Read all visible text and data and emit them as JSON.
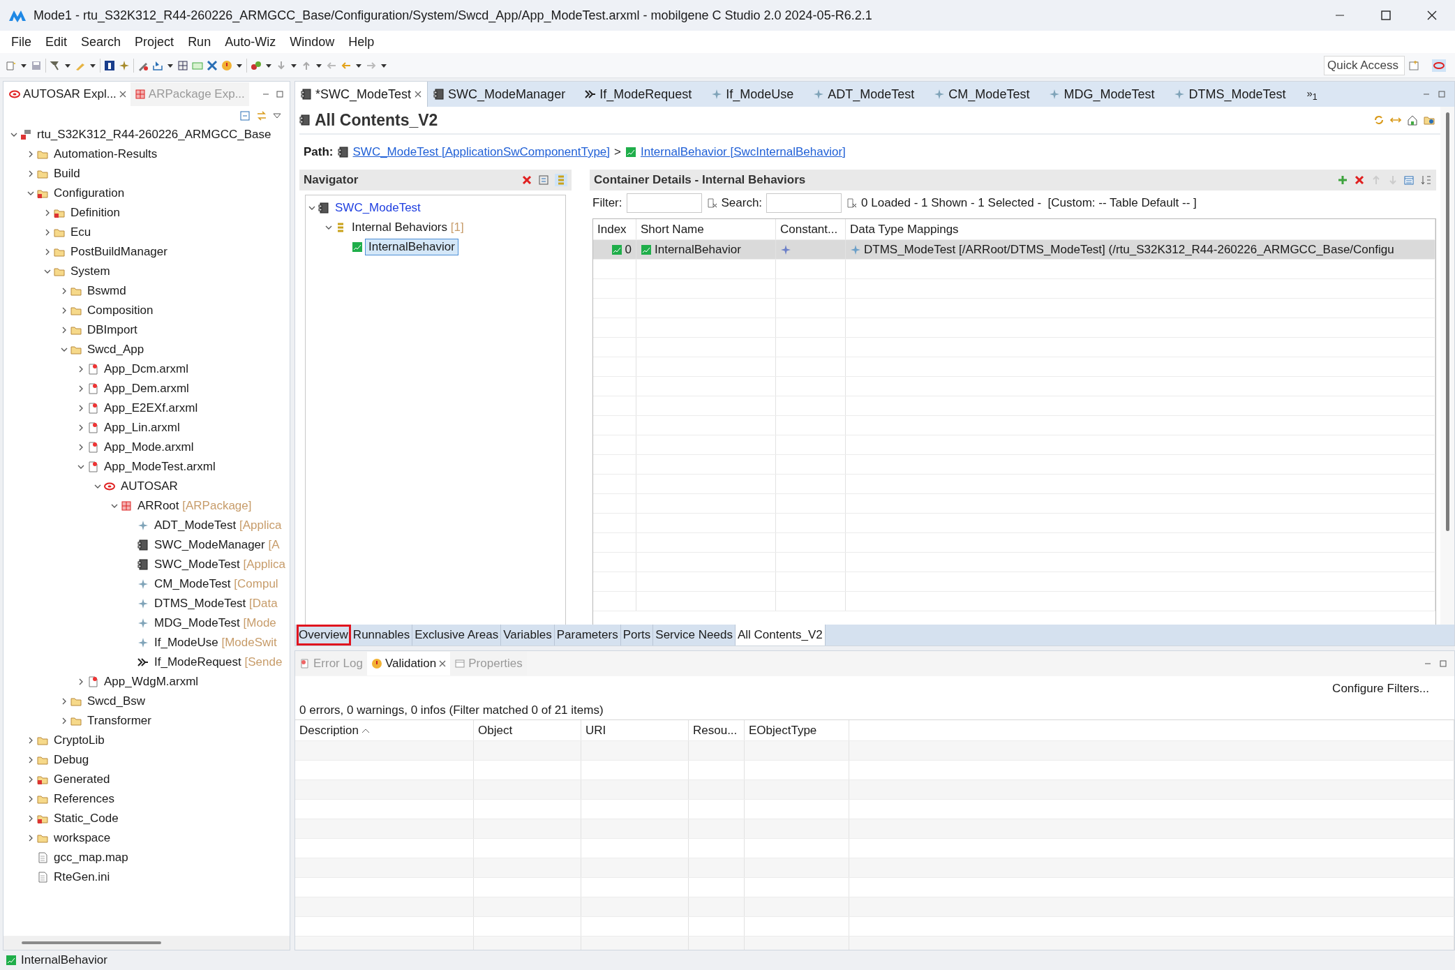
{
  "window": {
    "title": "Mode1 - rtu_S32K312_R44-260226_ARMGCC_Base/Configuration/System/Swcd_App/App_ModeTest.arxml - mobilgene C Studio 2.0 2024-05-R6.2.1"
  },
  "menu": [
    "File",
    "Edit",
    "Search",
    "Project",
    "Run",
    "Auto-Wiz",
    "Window",
    "Help"
  ],
  "quick_access": {
    "placeholder": "Quick Access"
  },
  "explorer": {
    "tabs": [
      {
        "label": "AUTOSAR Expl...",
        "selected": true
      },
      {
        "label": "ARPackage Exp...",
        "selected": false
      }
    ],
    "tree": [
      {
        "label": "rtu_S32K312_R44-260226_ARMGCC_Base",
        "kind": "project",
        "expanded": true,
        "children": [
          {
            "label": "Automation-Results",
            "kind": "folder",
            "expanded": false
          },
          {
            "label": "Build",
            "kind": "folder",
            "expanded": false
          },
          {
            "label": "Configuration",
            "kind": "errorfolder",
            "expanded": true,
            "children": [
              {
                "label": "Definition",
                "kind": "errorfolder",
                "expanded": false
              },
              {
                "label": "Ecu",
                "kind": "folder",
                "expanded": false
              },
              {
                "label": "PostBuildManager",
                "kind": "folder",
                "expanded": false
              },
              {
                "label": "System",
                "kind": "folder",
                "expanded": true,
                "children": [
                  {
                    "label": "Bswmd",
                    "kind": "folder",
                    "expanded": false
                  },
                  {
                    "label": "Composition",
                    "kind": "folder",
                    "expanded": false
                  },
                  {
                    "label": "DBImport",
                    "kind": "folder",
                    "expanded": false
                  },
                  {
                    "label": "Swcd_App",
                    "kind": "folder",
                    "expanded": true,
                    "children": [
                      {
                        "label": "App_Dcm.arxml",
                        "kind": "arxml",
                        "expanded": false
                      },
                      {
                        "label": "App_Dem.arxml",
                        "kind": "arxml",
                        "expanded": false
                      },
                      {
                        "label": "App_E2EXf.arxml",
                        "kind": "arxml",
                        "expanded": false
                      },
                      {
                        "label": "App_Lin.arxml",
                        "kind": "arxml",
                        "expanded": false
                      },
                      {
                        "label": "App_Mode.arxml",
                        "kind": "arxml",
                        "expanded": false
                      },
                      {
                        "label": "App_ModeTest.arxml",
                        "kind": "arxml",
                        "expanded": true,
                        "children": [
                          {
                            "label": "AUTOSAR",
                            "kind": "autosar",
                            "expanded": true,
                            "children": [
                              {
                                "label": "ARRoot",
                                "suffix": "[ARPackage]",
                                "kind": "package",
                                "expanded": true,
                                "children": [
                                  {
                                    "label": "ADT_ModeTest",
                                    "suffix": "[Applica",
                                    "kind": "element"
                                  },
                                  {
                                    "label": "SWC_ModeManager",
                                    "suffix": "[A",
                                    "kind": "component"
                                  },
                                  {
                                    "label": "SWC_ModeTest",
                                    "suffix": "[Applica",
                                    "kind": "component"
                                  },
                                  {
                                    "label": "CM_ModeTest",
                                    "suffix": "[Compul",
                                    "kind": "element"
                                  },
                                  {
                                    "label": "DTMS_ModeTest",
                                    "suffix": "[Data",
                                    "kind": "element"
                                  },
                                  {
                                    "label": "MDG_ModeTest",
                                    "suffix": "[Mode",
                                    "kind": "element"
                                  },
                                  {
                                    "label": "If_ModeUse",
                                    "suffix": "[ModeSwit",
                                    "kind": "element"
                                  },
                                  {
                                    "label": "If_ModeRequest",
                                    "suffix": "[Sende",
                                    "kind": "port"
                                  }
                                ]
                              }
                            ]
                          }
                        ]
                      },
                      {
                        "label": "App_WdgM.arxml",
                        "kind": "arxml",
                        "expanded": false
                      }
                    ]
                  },
                  {
                    "label": "Swcd_Bsw",
                    "kind": "folder",
                    "expanded": false
                  },
                  {
                    "label": "Transformer",
                    "kind": "folder",
                    "expanded": false
                  }
                ]
              }
            ]
          },
          {
            "label": "CryptoLib",
            "kind": "folder",
            "expanded": false
          },
          {
            "label": "Debug",
            "kind": "folder",
            "expanded": false
          },
          {
            "label": "Generated",
            "kind": "errorfolder",
            "expanded": false
          },
          {
            "label": "References",
            "kind": "folder",
            "expanded": false
          },
          {
            "label": "Static_Code",
            "kind": "errorfolder",
            "expanded": false
          },
          {
            "label": "workspace",
            "kind": "folder",
            "expanded": false
          },
          {
            "label": "gcc_map.map",
            "kind": "file"
          },
          {
            "label": "RteGen.ini",
            "kind": "file"
          }
        ]
      }
    ]
  },
  "editor_tabs": [
    {
      "label": "*SWC_ModeTest",
      "kind": "component",
      "selected": true
    },
    {
      "label": "SWC_ModeManager",
      "kind": "component",
      "selected": false
    },
    {
      "label": "If_ModeRequest",
      "kind": "port",
      "selected": false
    },
    {
      "label": "If_ModeUse",
      "kind": "element",
      "selected": false
    },
    {
      "label": "ADT_ModeTest",
      "kind": "element",
      "selected": false
    },
    {
      "label": "CM_ModeTest",
      "kind": "element",
      "selected": false
    },
    {
      "label": "MDG_ModeTest",
      "kind": "element",
      "selected": false
    },
    {
      "label": "DTMS_ModeTest",
      "kind": "element",
      "selected": false
    }
  ],
  "editor_tabs_overflow": "»$_{1}$",
  "editor": {
    "title": "All Contents_V2",
    "path": {
      "label": "Path:",
      "separator": ">",
      "links": [
        {
          "label": "SWC_ModeTest [ApplicationSwComponentType]",
          "kind": "component"
        },
        {
          "label": "InternalBehavior [SwcInternalBehavior]",
          "kind": "behavior"
        }
      ]
    },
    "navigator": {
      "title": "Navigator",
      "tree": [
        {
          "label": "SWC_ModeTest",
          "kind": "component",
          "expanded": true,
          "children": [
            {
              "label": "Internal Behaviors",
              "suffix": "[1]",
              "kind": "list",
              "expanded": true,
              "children": [
                {
                  "label": "InternalBehavior",
                  "kind": "behavior",
                  "selected": true
                }
              ]
            }
          ]
        }
      ]
    },
    "details": {
      "title": "Container Details - Internal Behaviors",
      "filter_label": "Filter:",
      "search_label": "Search:",
      "summary": "0 Loaded - 1 Shown - 1 Selected -  [Custom: -- Table Default -- ]",
      "columns": [
        "Index",
        "Short Name",
        "Constant...",
        "Data Type Mappings"
      ],
      "rows": [
        {
          "index": "0",
          "short_name": "InternalBehavior",
          "data_type_mappings": "DTMS_ModeTest [/ARRoot/DTMS_ModeTest] (/rtu_S32K312_R44-260226_ARMGCC_Base/Configu",
          "selected": true
        }
      ]
    },
    "page_tabs": [
      {
        "label": "Overview",
        "selected": false,
        "outlined": true
      },
      {
        "label": "Runnables",
        "selected": false,
        "outlined": false
      },
      {
        "label": "Exclusive Areas",
        "selected": false,
        "outlined": false
      },
      {
        "label": "Variables",
        "selected": false,
        "outlined": false
      },
      {
        "label": "Parameters",
        "selected": false,
        "outlined": false
      },
      {
        "label": "Ports",
        "selected": false,
        "outlined": false
      },
      {
        "label": "Service Needs",
        "selected": false,
        "outlined": false
      },
      {
        "label": "All Contents_V2",
        "selected": true,
        "outlined": false
      }
    ]
  },
  "bottom_panel": {
    "tabs": [
      {
        "label": "Error Log",
        "selected": false
      },
      {
        "label": "Validation",
        "selected": true
      },
      {
        "label": "Properties",
        "selected": false
      }
    ],
    "configure": "Configure Filters...",
    "summary": "0 errors, 0 warnings, 0 infos (Filter matched 0 of 21 items)",
    "columns": [
      {
        "label": "Description",
        "sorted": true
      },
      {
        "label": "Object",
        "sorted": false
      },
      {
        "label": "URI",
        "sorted": false
      },
      {
        "label": "Resou...",
        "sorted": false
      },
      {
        "label": "EObjectType",
        "sorted": false
      }
    ]
  },
  "status_bar": {
    "text": "InternalBehavior"
  }
}
